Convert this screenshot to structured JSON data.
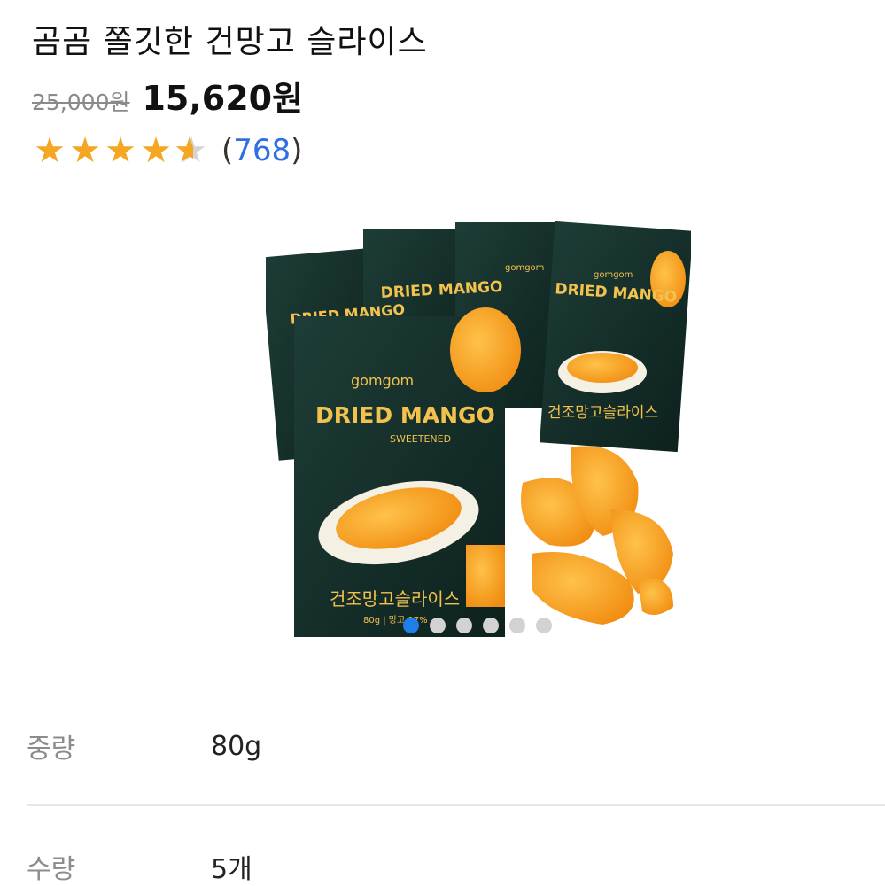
{
  "product": {
    "title": "곰곰 쫄깃한 건망고 슬라이스",
    "original_price": "25,000원",
    "sale_price": "15,620원",
    "rating": 4.5,
    "review_count_open": "(",
    "review_count": "768",
    "review_count_close": ")"
  },
  "image": {
    "brand": "gomgom",
    "pack_title": "DRIED MANGO",
    "pack_subtitle": "SWEETENED",
    "pack_korean": "건조망고슬라이스",
    "pack_weight": "80g | 망고 97%",
    "carousel_total": 6,
    "carousel_active": 0
  },
  "specs": [
    {
      "label": "중량",
      "value": "80g"
    },
    {
      "label": "수량",
      "value": "5개"
    }
  ],
  "colors": {
    "accent": "#1f7ee8",
    "star": "#f5a623",
    "review_link": "#2f6fe0",
    "pack_dark": "#14302b",
    "mango": "#f6a21e"
  }
}
